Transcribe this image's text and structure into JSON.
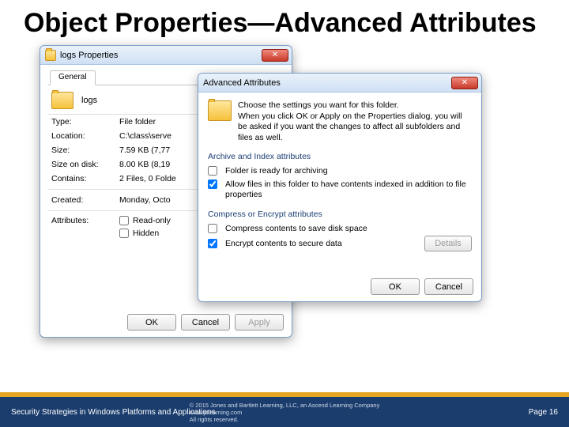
{
  "slide": {
    "title": "Object Properties—Advanced Attributes"
  },
  "props_window": {
    "title": "logs Properties",
    "tab": "General",
    "folder_name": "logs",
    "rows": {
      "type_k": "Type:",
      "type_v": "File folder",
      "loc_k": "Location:",
      "loc_v": "C:\\class\\serve",
      "size_k": "Size:",
      "size_v": "7.59 KB (7,77",
      "disk_k": "Size on disk:",
      "disk_v": "8.00 KB (8,19",
      "cont_k": "Contains:",
      "cont_v": "2 Files, 0 Folde",
      "created_k": "Created:",
      "created_v": "Monday, Octo",
      "attr_k": "Attributes:"
    },
    "attrs": {
      "readonly": "Read-only",
      "hidden": "Hidden"
    },
    "buttons": {
      "ok": "OK",
      "cancel": "Cancel",
      "apply": "Apply"
    }
  },
  "adv_window": {
    "title": "Advanced Attributes",
    "intro1": "Choose the settings you want for this folder.",
    "intro2": "When you click OK or Apply on the Properties dialog, you will be asked if you want the changes to affect all subfolders and files as well.",
    "group1": "Archive and Index attributes",
    "chk_archive": "Folder is ready for archiving",
    "chk_index": "Allow files in this folder to have contents indexed in addition to file properties",
    "group2": "Compress or Encrypt attributes",
    "chk_compress": "Compress contents to save disk space",
    "chk_encrypt": "Encrypt contents to secure data",
    "details": "Details",
    "ok": "OK",
    "cancel": "Cancel"
  },
  "footer": {
    "book": "Security Strategies in Windows Platforms and Applications",
    "copy1": "© 2015 Jones and Bartlett Learning, LLC, an Ascend Learning Company",
    "copy2": "www.jblearning.com",
    "copy3": "All rights reserved.",
    "page": "Page 16"
  }
}
